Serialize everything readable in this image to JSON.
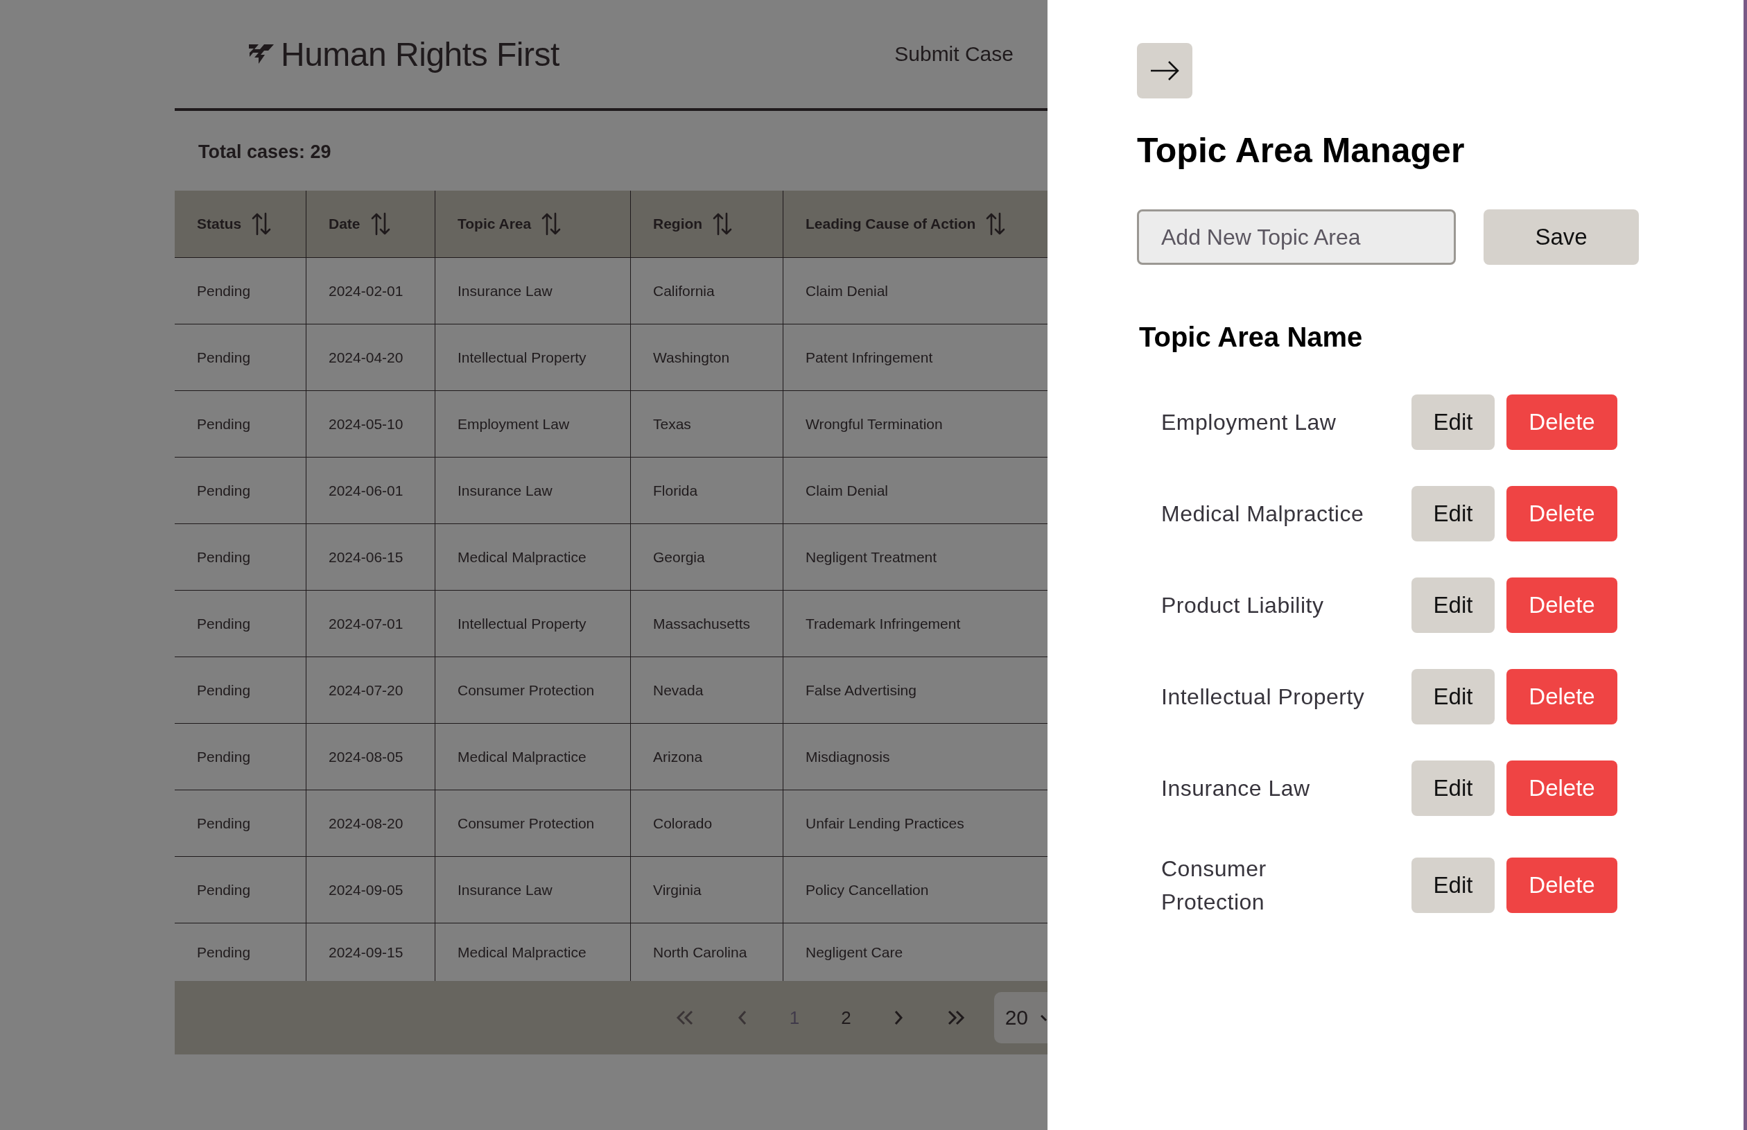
{
  "header": {
    "brand": "Human Rights First",
    "nav_link": "Submit Case"
  },
  "total_cases": "Total cases: 29",
  "table": {
    "columns": [
      "Status",
      "Date",
      "Topic Area",
      "Region",
      "Leading Cause of Action"
    ],
    "rows": [
      [
        "Pending",
        "2024-02-01",
        "Insurance Law",
        "California",
        "Claim Denial"
      ],
      [
        "Pending",
        "2024-04-20",
        "Intellectual Property",
        "Washington",
        "Patent Infringement"
      ],
      [
        "Pending",
        "2024-05-10",
        "Employment Law",
        "Texas",
        "Wrongful Termination"
      ],
      [
        "Pending",
        "2024-06-01",
        "Insurance Law",
        "Florida",
        "Claim Denial"
      ],
      [
        "Pending",
        "2024-06-15",
        "Medical Malpractice",
        "Georgia",
        "Negligent Treatment"
      ],
      [
        "Pending",
        "2024-07-01",
        "Intellectual Property",
        "Massachusetts",
        "Trademark Infringement"
      ],
      [
        "Pending",
        "2024-07-20",
        "Consumer Protection",
        "Nevada",
        "False Advertising"
      ],
      [
        "Pending",
        "2024-08-05",
        "Medical Malpractice",
        "Arizona",
        "Misdiagnosis"
      ],
      [
        "Pending",
        "2024-08-20",
        "Consumer Protection",
        "Colorado",
        "Unfair Lending Practices"
      ],
      [
        "Pending",
        "2024-09-05",
        "Insurance Law",
        "Virginia",
        "Policy Cancellation"
      ],
      [
        "Pending",
        "2024-09-15",
        "Medical Malpractice",
        "North Carolina",
        "Negligent Care"
      ]
    ]
  },
  "pagination": {
    "pages": [
      {
        "label": "1",
        "selected": true
      },
      {
        "label": "2",
        "selected": false
      }
    ],
    "page_size": "20"
  },
  "panel": {
    "title": "Topic Area Manager",
    "input": {
      "placeholder": "Add New Topic Area"
    },
    "save_button": "Save",
    "list_heading": "Topic Area Name",
    "items": [
      {
        "name": "Employment Law",
        "edit": "Edit",
        "delete": "Delete"
      },
      {
        "name": "Medical Malpractice",
        "edit": "Edit",
        "delete": "Delete"
      },
      {
        "name": "Product Liability",
        "edit": "Edit",
        "delete": "Delete"
      },
      {
        "name": "Intellectual Property",
        "edit": "Edit",
        "delete": "Delete"
      },
      {
        "name": "Insurance Law",
        "edit": "Edit",
        "delete": "Delete"
      },
      {
        "name": "Consumer Protection",
        "edit": "Edit",
        "delete": "Delete"
      }
    ]
  }
}
